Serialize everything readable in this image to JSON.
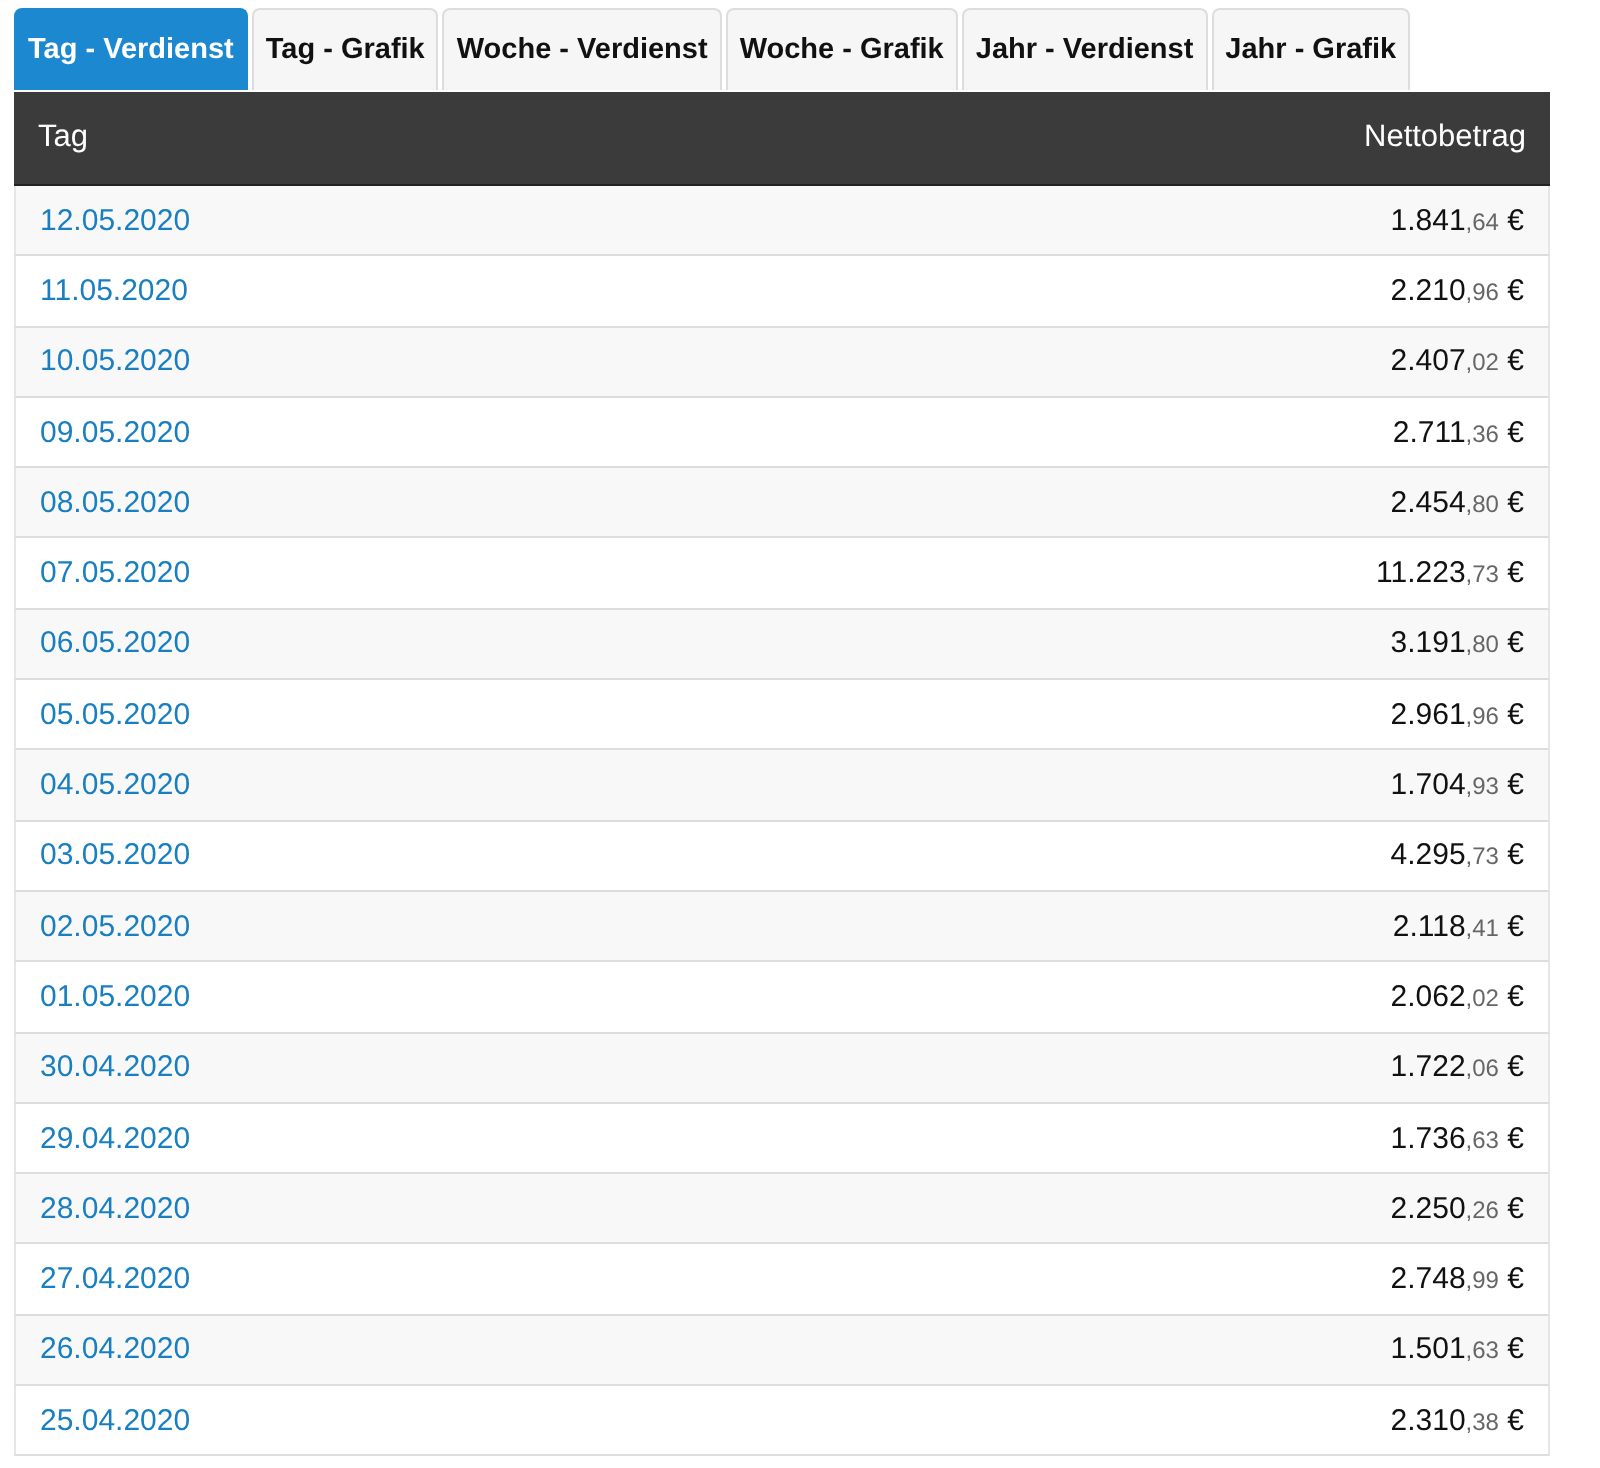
{
  "tabs": [
    {
      "label": "Tag - Verdienst",
      "selected": true
    },
    {
      "label": "Tag - Grafik",
      "selected": false
    },
    {
      "label": "Woche - Verdienst",
      "selected": false
    },
    {
      "label": "Woche - Grafik",
      "selected": false
    },
    {
      "label": "Jahr - Verdienst",
      "selected": false
    },
    {
      "label": "Jahr - Grafik",
      "selected": false
    }
  ],
  "table": {
    "columns": [
      "Tag",
      "Nettobetrag"
    ],
    "rows": [
      {
        "date": "12.05.2020",
        "amount": "1.841",
        "cents": ",64",
        "currency": "€"
      },
      {
        "date": "11.05.2020",
        "amount": "2.210",
        "cents": ",96",
        "currency": "€"
      },
      {
        "date": "10.05.2020",
        "amount": "2.407",
        "cents": ",02",
        "currency": "€"
      },
      {
        "date": "09.05.2020",
        "amount": "2.711",
        "cents": ",36",
        "currency": "€"
      },
      {
        "date": "08.05.2020",
        "amount": "2.454",
        "cents": ",80",
        "currency": "€"
      },
      {
        "date": "07.05.2020",
        "amount": "11.223",
        "cents": ",73",
        "currency": "€"
      },
      {
        "date": "06.05.2020",
        "amount": "3.191",
        "cents": ",80",
        "currency": "€"
      },
      {
        "date": "05.05.2020",
        "amount": "2.961",
        "cents": ",96",
        "currency": "€"
      },
      {
        "date": "04.05.2020",
        "amount": "1.704",
        "cents": ",93",
        "currency": "€"
      },
      {
        "date": "03.05.2020",
        "amount": "4.295",
        "cents": ",73",
        "currency": "€"
      },
      {
        "date": "02.05.2020",
        "amount": "2.118",
        "cents": ",41",
        "currency": "€"
      },
      {
        "date": "01.05.2020",
        "amount": "2.062",
        "cents": ",02",
        "currency": "€"
      },
      {
        "date": "30.04.2020",
        "amount": "1.722",
        "cents": ",06",
        "currency": "€"
      },
      {
        "date": "29.04.2020",
        "amount": "1.736",
        "cents": ",63",
        "currency": "€"
      },
      {
        "date": "28.04.2020",
        "amount": "2.250",
        "cents": ",26",
        "currency": "€"
      },
      {
        "date": "27.04.2020",
        "amount": "2.748",
        "cents": ",99",
        "currency": "€"
      },
      {
        "date": "26.04.2020",
        "amount": "1.501",
        "cents": ",63",
        "currency": "€"
      },
      {
        "date": "25.04.2020",
        "amount": "2.310",
        "cents": ",38",
        "currency": "€"
      }
    ]
  }
}
